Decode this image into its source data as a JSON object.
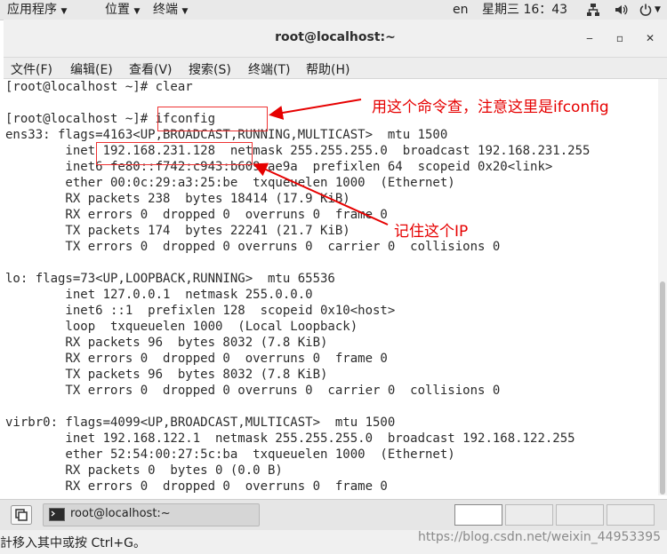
{
  "topbar": {
    "applications": "应用程序",
    "places": "位置",
    "terminal": "终端",
    "lang": "en",
    "datetime": "星期三 16：43",
    "icons": [
      "network-icon",
      "volume-icon",
      "power-icon"
    ]
  },
  "window": {
    "title": "root@localhost:~",
    "controls": [
      "minimize-icon",
      "maximize-icon",
      "close-icon"
    ]
  },
  "menubar": {
    "items": [
      "文件(F)",
      "编辑(E)",
      "查看(V)",
      "搜索(S)",
      "终端(T)",
      "帮助(H)"
    ]
  },
  "terminal": {
    "lines": [
      "[root@localhost ~]# clear",
      "",
      "[root@localhost ~]# ifconfig",
      "ens33: flags=4163<UP,BROADCAST,RUNNING,MULTICAST>  mtu 1500",
      "        inet 192.168.231.128  netmask 255.255.255.0  broadcast 192.168.231.255",
      "        inet6 fe80::f742:c943:b609:ae9a  prefixlen 64  scopeid 0x20<link>",
      "        ether 00:0c:29:a3:25:be  txqueuelen 1000  (Ethernet)",
      "        RX packets 238  bytes 18414 (17.9 KiB)",
      "        RX errors 0  dropped 0  overruns 0  frame 0",
      "        TX packets 174  bytes 22241 (21.7 KiB)",
      "        TX errors 0  dropped 0 overruns 0  carrier 0  collisions 0",
      "",
      "lo: flags=73<UP,LOOPBACK,RUNNING>  mtu 65536",
      "        inet 127.0.0.1  netmask 255.0.0.0",
      "        inet6 ::1  prefixlen 128  scopeid 0x10<host>",
      "        loop  txqueuelen 1000  (Local Loopback)",
      "        RX packets 96  bytes 8032 (7.8 KiB)",
      "        RX errors 0  dropped 0  overruns 0  frame 0",
      "        TX packets 96  bytes 8032 (7.8 KiB)",
      "        TX errors 0  dropped 0 overruns 0  carrier 0  collisions 0",
      "",
      "virbr0: flags=4099<UP,BROADCAST,MULTICAST>  mtu 1500",
      "        inet 192.168.122.1  netmask 255.255.255.0  broadcast 192.168.122.255",
      "        ether 52:54:00:27:5c:ba  txqueuelen 1000  (Ethernet)",
      "        RX packets 0  bytes 0 (0.0 B)",
      "        RX errors 0  dropped 0  overruns 0  frame 0"
    ]
  },
  "annotations": {
    "command_note": "用这个命令查，注意这里是ifconfig",
    "ip_note": "记住这个IP",
    "color": "#e60000"
  },
  "taskbar": {
    "show_desktop_icon": "show-desktop-icon",
    "task_label": "root@localhost:~",
    "workspaces": 4,
    "active_workspace": 1
  },
  "statusbar": {
    "hint": "計移入其中或按 Ctrl+G。",
    "watermark": "https://blog.csdn.net/weixin_44953395"
  }
}
